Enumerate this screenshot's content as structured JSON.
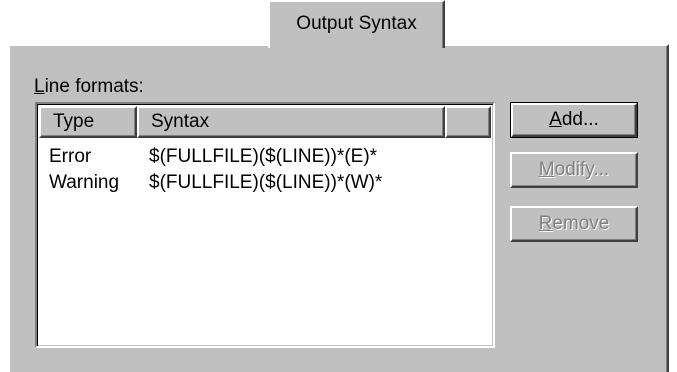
{
  "tab": {
    "label": "Output Syntax"
  },
  "group": {
    "label_mnemonic": "L",
    "label_rest": "ine formats:"
  },
  "list": {
    "columns": [
      "Type",
      "Syntax"
    ],
    "rows": [
      {
        "type": "Error",
        "syntax": "$(FULLFILE)($(LINE))*(E)*"
      },
      {
        "type": "Warning",
        "syntax": "$(FULLFILE)($(LINE))*(W)*"
      }
    ]
  },
  "buttons": {
    "add": {
      "mnemonic": "A",
      "rest": "dd..."
    },
    "modify": {
      "mnemonic": "M",
      "rest": "odify..."
    },
    "remove": {
      "mnemonic": "R",
      "rest": "emove"
    }
  },
  "colors": {
    "face": "#c0c0c0",
    "disabled_text": "#808080"
  }
}
